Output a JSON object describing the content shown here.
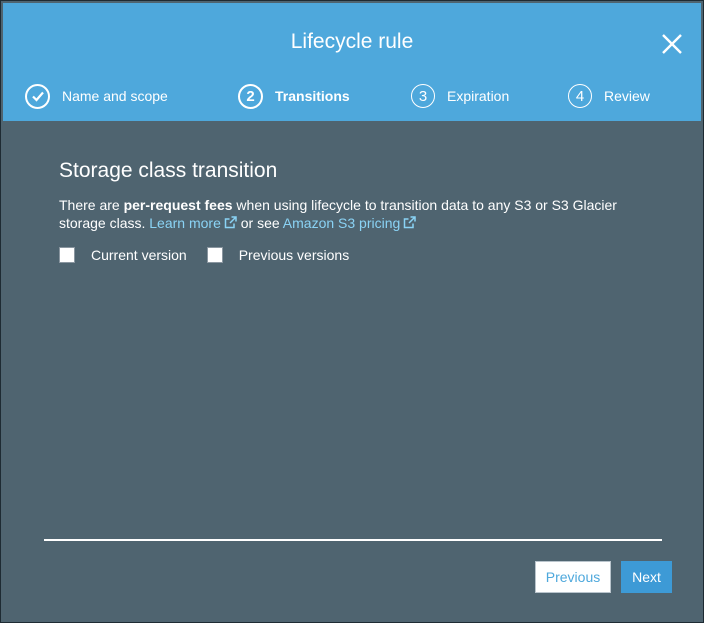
{
  "modal": {
    "title": "Lifecycle rule"
  },
  "steps": [
    {
      "number": "",
      "label": "Name and scope",
      "state": "done"
    },
    {
      "number": "2",
      "label": "Transitions",
      "state": "active"
    },
    {
      "number": "3",
      "label": "Expiration",
      "state": "inactive"
    },
    {
      "number": "4",
      "label": "Review",
      "state": "inactive"
    }
  ],
  "section": {
    "title": "Storage class transition",
    "desc_part1": "There are ",
    "desc_bold": "per-request fees",
    "desc_part2": " when using lifecycle to transition data to any S3 or S3 Glacier storage class. ",
    "learn_more": "Learn more",
    "desc_part3": " or see ",
    "pricing_link": "Amazon S3 pricing"
  },
  "checkboxes": [
    {
      "label": "Current version",
      "checked": false
    },
    {
      "label": "Previous versions",
      "checked": false
    }
  ],
  "footer": {
    "previous_label": "Previous",
    "next_label": "Next"
  },
  "colors": {
    "header": "#4ea8dc",
    "body": "#4f6470",
    "link": "#8ad3f5",
    "primary_button": "#3d9ad6"
  }
}
